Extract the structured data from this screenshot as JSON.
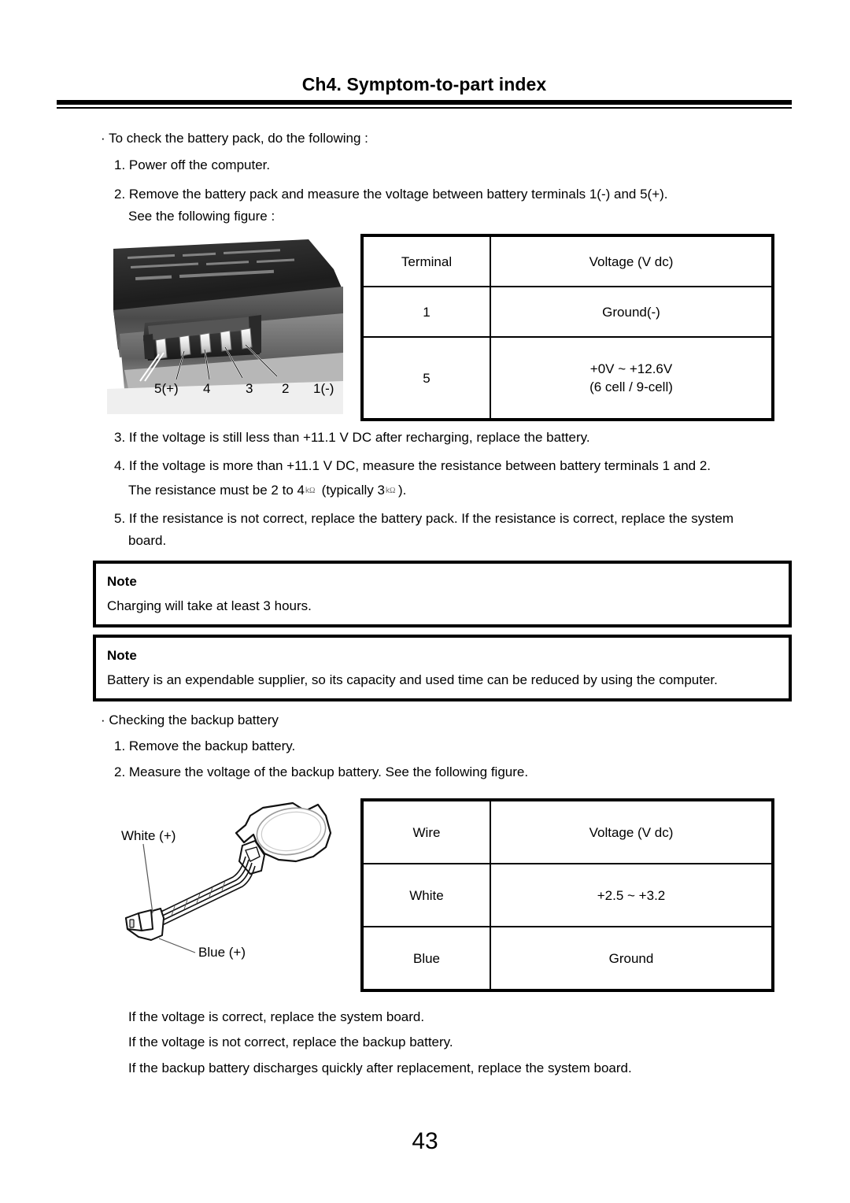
{
  "header": {
    "title": "Ch4. Symptom-to-part index"
  },
  "battery_check": {
    "lead": "To check the battery pack, do the following :",
    "steps": [
      "1. Power off the computer.",
      "2. Remove the battery pack and measure the voltage between battery  terminals 1(-) and 5(+).",
      "See the following figure :",
      "3. If the voltage is still less than +11.1 V DC after recharging, replace the battery.",
      "4. If the voltage is more than +11.1 V DC, measure the resistance between battery terminals 1 and 2.",
      "5. If the resistance is not correct, replace the battery pack. If the resistance is correct, replace the system",
      "board."
    ],
    "resistance_line": {
      "prefix": "The resistance must be 2 to 4",
      "middle": " (typically 3",
      "suffix": ").",
      "unit": "kilo-ohm"
    }
  },
  "terminal_table": {
    "headers": [
      "Terminal",
      "Voltage (V dc)"
    ],
    "rows": [
      {
        "terminal": "1",
        "voltage": "Ground(-)",
        "voltage2": ""
      },
      {
        "terminal": "5",
        "voltage": "+0V ~ +12.6V",
        "voltage2": "(6 cell / 9-cell)"
      }
    ]
  },
  "battery_photo": {
    "caption_labels": [
      "5(+)",
      "4",
      "3",
      "2",
      "1(-)"
    ],
    "alt": "Battery pack connector with five terminals"
  },
  "notes": [
    {
      "title": "Note",
      "body": "Charging will take at least 3 hours."
    },
    {
      "title": "Note",
      "body": "Battery is an expendable supplier, so its capacity and used time can be reduced by using the computer."
    }
  ],
  "backup_check": {
    "lead": "Checking the backup battery",
    "steps": [
      "1. Remove the backup battery.",
      "2. Measure the voltage of the backup battery. See the following figure."
    ],
    "conclusions": [
      "If the voltage is correct, replace the system board.",
      "If the voltage is not correct, replace the backup battery.",
      "If the backup battery discharges quickly after replacement, replace the system board."
    ]
  },
  "backup_figure": {
    "labels": {
      "white": "White (+)",
      "blue": "Blue (+)"
    },
    "alt": "Backup coin cell battery with wire harness and connector"
  },
  "wire_table": {
    "headers": [
      "Wire",
      "Voltage (V dc)"
    ],
    "rows": [
      {
        "wire": "White",
        "voltage": "+2.5 ~ +3.2"
      },
      {
        "wire": "Blue",
        "voltage": "Ground"
      }
    ]
  },
  "page_number": "43"
}
